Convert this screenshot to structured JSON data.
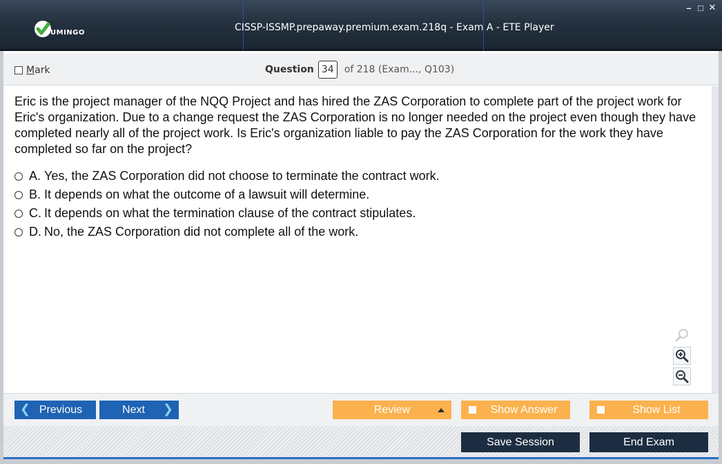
{
  "window": {
    "title": "CISSP-ISSMP.prepaway.premium.exam.218q - Exam A - ETE Player",
    "logo_text": "UMINGO",
    "controls": {
      "minimize": "–",
      "maximize": "□",
      "close": "✕"
    }
  },
  "header": {
    "mark_label": "Mark",
    "question_label": "Question",
    "question_number": "34",
    "question_of": "of 218 (Exam..., Q103)"
  },
  "question": {
    "text": "Eric is the project manager of the NQQ Project and has hired the ZAS Corporation to complete part of the project work for Eric's organization. Due to a change request the ZAS Corporation is no longer needed on the project even though they have completed nearly all of the project work. Is Eric's organization liable to pay the ZAS Corporation for the work they have completed so far on the project?",
    "answers": [
      {
        "letter": "A.",
        "text": "Yes, the ZAS Corporation did not choose to terminate the contract work."
      },
      {
        "letter": "B.",
        "text": "It depends on what the outcome of a lawsuit will determine."
      },
      {
        "letter": "C.",
        "text": "It depends on what the termination clause of the contract stipulates."
      },
      {
        "letter": "D.",
        "text": "No, the ZAS Corporation did not complete all of the work."
      }
    ]
  },
  "toolbar": {
    "previous_label": "Previous",
    "next_label": "Next",
    "review_label": "Review",
    "show_answer_label": "Show Answer",
    "show_list_label": "Show List"
  },
  "session": {
    "save_label": "Save Session",
    "end_label": "End Exam"
  },
  "colors": {
    "titlebar": "#24313f",
    "nav_blue": "#1e63b4",
    "orange": "#fbb24e",
    "dark_button": "#1d2d41",
    "accent_line": "#2a6fc6"
  },
  "icons": {
    "logo": "vumingo-check-logo",
    "search": "search-icon",
    "zoom_in": "zoom-in-icon",
    "zoom_out": "zoom-out-icon"
  }
}
